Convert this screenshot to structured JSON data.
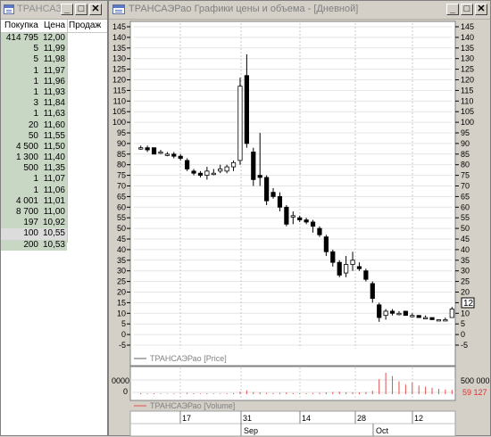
{
  "order_book": {
    "title": "ТРАНСАЗ",
    "columns": [
      "Покупка",
      "Цена",
      "Продаж"
    ],
    "rows": [
      {
        "qty": "414 795",
        "price": "12,00"
      },
      {
        "qty": "5",
        "price": "11,99"
      },
      {
        "qty": "5",
        "price": "11,98"
      },
      {
        "qty": "1",
        "price": "11,97"
      },
      {
        "qty": "1",
        "price": "11,96"
      },
      {
        "qty": "1",
        "price": "11,93"
      },
      {
        "qty": "3",
        "price": "11,84"
      },
      {
        "qty": "1",
        "price": "11,63"
      },
      {
        "qty": "20",
        "price": "11,60"
      },
      {
        "qty": "50",
        "price": "11,55"
      },
      {
        "qty": "4 500",
        "price": "11,50"
      },
      {
        "qty": "1 300",
        "price": "11,40"
      },
      {
        "qty": "500",
        "price": "11,35"
      },
      {
        "qty": "1",
        "price": "11,07"
      },
      {
        "qty": "1",
        "price": "11,06"
      },
      {
        "qty": "4 001",
        "price": "11,01"
      },
      {
        "qty": "8 700",
        "price": "11,00"
      },
      {
        "qty": "197",
        "price": "10,92"
      },
      {
        "qty": "100",
        "price": "10,55"
      },
      {
        "qty": "200",
        "price": "10,53"
      }
    ],
    "selected_row": 18
  },
  "chart_window": {
    "title": "ТРАНСАЭРао Графики цены и объема - [Дневной]",
    "buttons": {
      "minimize": "_",
      "maximize": "□",
      "close": "✕"
    }
  },
  "chart_data": [
    {
      "type": "candlestick",
      "title": "",
      "legend": "ТРАНСАЭРао [Price]",
      "y_ticks": [
        145,
        140,
        135,
        130,
        125,
        120,
        115,
        110,
        105,
        100,
        95,
        90,
        85,
        80,
        75,
        70,
        65,
        60,
        55,
        50,
        45,
        40,
        35,
        30,
        25,
        20,
        15,
        10,
        5,
        0,
        -5
      ],
      "ylim": [
        -5,
        145
      ],
      "last_price_label": "12",
      "grid": true,
      "candles": [
        {
          "o": 88,
          "h": 89,
          "l": 87,
          "c": 88
        },
        {
          "o": 88,
          "h": 89,
          "l": 86,
          "c": 87
        },
        {
          "o": 88,
          "h": 88,
          "l": 85,
          "c": 85
        },
        {
          "o": 86,
          "h": 87,
          "l": 85,
          "c": 86
        },
        {
          "o": 85,
          "h": 86,
          "l": 84,
          "c": 85
        },
        {
          "o": 85,
          "h": 86,
          "l": 83,
          "c": 84
        },
        {
          "o": 84,
          "h": 85,
          "l": 82,
          "c": 83
        },
        {
          "o": 82,
          "h": 83,
          "l": 77,
          "c": 78
        },
        {
          "o": 77,
          "h": 78,
          "l": 75,
          "c": 76
        },
        {
          "o": 76,
          "h": 77,
          "l": 74,
          "c": 75
        },
        {
          "o": 75,
          "h": 79,
          "l": 73,
          "c": 77
        },
        {
          "o": 76,
          "h": 78,
          "l": 75,
          "c": 76
        },
        {
          "o": 77,
          "h": 80,
          "l": 76,
          "c": 78
        },
        {
          "o": 77,
          "h": 80,
          "l": 76,
          "c": 79
        },
        {
          "o": 79,
          "h": 82,
          "l": 77,
          "c": 81
        },
        {
          "o": 82,
          "h": 121,
          "l": 80,
          "c": 117
        },
        {
          "o": 122,
          "h": 132,
          "l": 88,
          "c": 90
        },
        {
          "o": 86,
          "h": 88,
          "l": 70,
          "c": 73
        },
        {
          "o": 75,
          "h": 95,
          "l": 70,
          "c": 74
        },
        {
          "o": 74,
          "h": 75,
          "l": 61,
          "c": 63
        },
        {
          "o": 67,
          "h": 69,
          "l": 64,
          "c": 65
        },
        {
          "o": 65,
          "h": 67,
          "l": 58,
          "c": 60
        },
        {
          "o": 60,
          "h": 61,
          "l": 51,
          "c": 52
        },
        {
          "o": 56,
          "h": 58,
          "l": 52,
          "c": 56
        },
        {
          "o": 55,
          "h": 56,
          "l": 53,
          "c": 54
        },
        {
          "o": 54,
          "h": 55,
          "l": 52,
          "c": 53
        },
        {
          "o": 53,
          "h": 54,
          "l": 48,
          "c": 51
        },
        {
          "o": 50,
          "h": 51,
          "l": 46,
          "c": 47
        },
        {
          "o": 46,
          "h": 47,
          "l": 37,
          "c": 39
        },
        {
          "o": 39,
          "h": 40,
          "l": 32,
          "c": 34
        },
        {
          "o": 34,
          "h": 35,
          "l": 27,
          "c": 28
        },
        {
          "o": 29,
          "h": 37,
          "l": 27,
          "c": 33
        },
        {
          "o": 33,
          "h": 39,
          "l": 30,
          "c": 35
        },
        {
          "o": 32,
          "h": 34,
          "l": 30,
          "c": 31
        },
        {
          "o": 30,
          "h": 31,
          "l": 25,
          "c": 26
        },
        {
          "o": 24,
          "h": 25,
          "l": 15,
          "c": 17
        },
        {
          "o": 14,
          "h": 15,
          "l": 6,
          "c": 8
        },
        {
          "o": 9,
          "h": 12,
          "l": 7,
          "c": 11
        },
        {
          "o": 11,
          "h": 12,
          "l": 9,
          "c": 10
        },
        {
          "o": 10,
          "h": 11,
          "l": 9,
          "c": 10
        },
        {
          "o": 11,
          "h": 11,
          "l": 9,
          "c": 9
        },
        {
          "o": 9,
          "h": 10,
          "l": 8,
          "c": 9
        },
        {
          "o": 9,
          "h": 9,
          "l": 8,
          "c": 8
        },
        {
          "o": 8,
          "h": 9,
          "l": 8,
          "c": 8
        },
        {
          "o": 8,
          "h": 8,
          "l": 7,
          "c": 7
        },
        {
          "o": 7,
          "h": 7,
          "l": 7,
          "c": 7
        },
        {
          "o": 7,
          "h": 8,
          "l": 7,
          "c": 7
        },
        {
          "o": 8,
          "h": 13,
          "l": 8,
          "c": 12
        }
      ]
    },
    {
      "type": "bar",
      "title": "",
      "legend": "ТРАНСАЭРао [Volume]",
      "y_tick_right": "500 000",
      "y_ticks_left": [
        "0000",
        "0"
      ],
      "last_volume_label": "59 127",
      "values": [
        5,
        3,
        4,
        3,
        2,
        3,
        2,
        6,
        4,
        3,
        4,
        3,
        3,
        4,
        5,
        12,
        18,
        10,
        9,
        6,
        5,
        6,
        8,
        5,
        4,
        4,
        5,
        6,
        8,
        10,
        12,
        9,
        9,
        8,
        10,
        16,
        70,
        100,
        85,
        60,
        45,
        55,
        40,
        35,
        30,
        25,
        22,
        20
      ],
      "ymax": 500000
    }
  ],
  "x_axis": {
    "day_labels": [
      "17",
      "31",
      "14",
      "28",
      "12"
    ],
    "month_labels": [
      "Sep",
      "Oct"
    ]
  },
  "colors": {
    "volume_bar": "#e05050",
    "last_volume_text": "#e03030",
    "window_bg": "#d4d0c8"
  }
}
